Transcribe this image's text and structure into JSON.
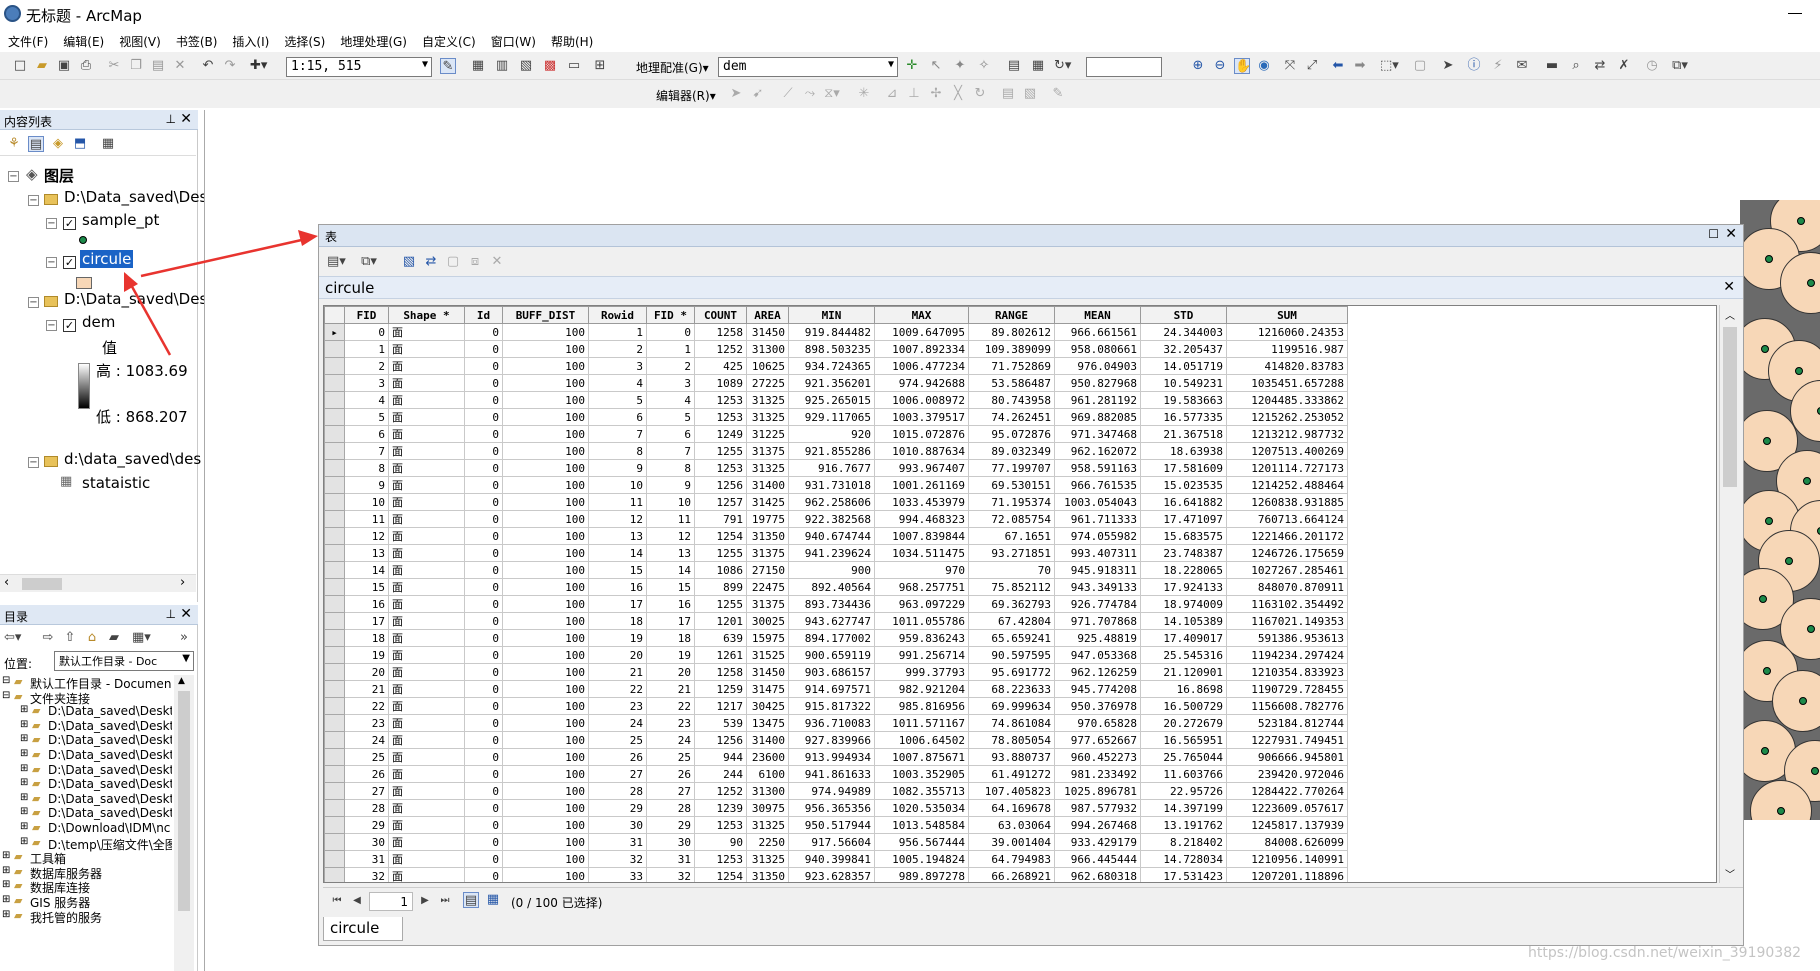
{
  "app": {
    "title": "无标题 - ArcMap"
  },
  "menu": [
    "文件(F)",
    "编辑(E)",
    "视图(V)",
    "书签(B)",
    "插入(I)",
    "选择(S)",
    "地理处理(G)",
    "自定义(C)",
    "窗口(W)",
    "帮助(H)"
  ],
  "toolbar": {
    "scale": "1:15, 515",
    "georef_label": "地理配准(G)▾",
    "georef_layer": "dem",
    "editor_label": "编辑器(R)▾"
  },
  "toc": {
    "title": "内容列表",
    "layers_label": "图层",
    "group1": "D:\\Data_saved\\Des",
    "layer_sample": "sample_pt",
    "layer_circle": "circule",
    "group2": "D:\\Data_saved\\Des",
    "layer_dem": "dem",
    "dem_value": "值",
    "dem_high": "高 : 1083.69",
    "dem_low": "低 : 868.207",
    "group3": "d:\\data_saved\\des",
    "table_name": "stataistic"
  },
  "catalog": {
    "title": "目录",
    "location_label": "位置:",
    "location_value": "默认工作目录 - Doc",
    "items": [
      "默认工作目录 - Documen",
      "文件夹连接",
      "D:\\Data_saved\\Deskt",
      "D:\\Data_saved\\Deskt",
      "D:\\Data_saved\\Deskt",
      "D:\\Data_saved\\Deskt",
      "D:\\Data_saved\\Deskt",
      "D:\\Data_saved\\Deskt",
      "D:\\Data_saved\\Deskt",
      "D:\\Data_saved\\Deskt",
      "D:\\Download\\IDM\\nc",
      "D:\\temp\\压缩文件\\全图",
      "工具箱",
      "数据库服务器",
      "数据库连接",
      "GIS 服务器",
      "我托管的服务"
    ]
  },
  "table_window": {
    "title": "表",
    "tab_name": "circule",
    "bottom_tab": "circule",
    "record_num": "1",
    "selection_status": "(0 / 100 已选择)",
    "columns": [
      "FID",
      "Shape *",
      "Id",
      "BUFF_DIST",
      "Rowid",
      "FID *",
      "COUNT",
      "AREA",
      "MIN",
      "MAX",
      "RANGE",
      "MEAN",
      "STD",
      "SUM"
    ],
    "rows": [
      [
        "0",
        "面",
        "0",
        "100",
        "1",
        "0",
        "1258",
        "31450",
        "919.844482",
        "1009.647095",
        "89.802612",
        "966.661561",
        "24.344003",
        "1216060.24353"
      ],
      [
        "1",
        "面",
        "0",
        "100",
        "2",
        "1",
        "1252",
        "31300",
        "898.503235",
        "1007.892334",
        "109.389099",
        "958.080661",
        "32.205437",
        "1199516.987"
      ],
      [
        "2",
        "面",
        "0",
        "100",
        "3",
        "2",
        "425",
        "10625",
        "934.724365",
        "1006.477234",
        "71.752869",
        "976.04903",
        "14.051719",
        "414820.83783"
      ],
      [
        "3",
        "面",
        "0",
        "100",
        "4",
        "3",
        "1089",
        "27225",
        "921.356201",
        "974.942688",
        "53.586487",
        "950.827968",
        "10.549231",
        "1035451.657288"
      ],
      [
        "4",
        "面",
        "0",
        "100",
        "5",
        "4",
        "1253",
        "31325",
        "925.265015",
        "1006.008972",
        "80.743958",
        "961.281192",
        "19.583663",
        "1204485.333862"
      ],
      [
        "5",
        "面",
        "0",
        "100",
        "6",
        "5",
        "1253",
        "31325",
        "929.117065",
        "1003.379517",
        "74.262451",
        "969.882085",
        "16.577335",
        "1215262.253052"
      ],
      [
        "6",
        "面",
        "0",
        "100",
        "7",
        "6",
        "1249",
        "31225",
        "920",
        "1015.072876",
        "95.072876",
        "971.347468",
        "21.367518",
        "1213212.987732"
      ],
      [
        "7",
        "面",
        "0",
        "100",
        "8",
        "7",
        "1255",
        "31375",
        "921.855286",
        "1010.887634",
        "89.032349",
        "962.162072",
        "18.63938",
        "1207513.400269"
      ],
      [
        "8",
        "面",
        "0",
        "100",
        "9",
        "8",
        "1253",
        "31325",
        "916.7677",
        "993.967407",
        "77.199707",
        "958.591163",
        "17.581609",
        "1201114.727173"
      ],
      [
        "9",
        "面",
        "0",
        "100",
        "10",
        "9",
        "1256",
        "31400",
        "931.731018",
        "1001.261169",
        "69.530151",
        "966.761535",
        "15.023535",
        "1214252.488464"
      ],
      [
        "10",
        "面",
        "0",
        "100",
        "11",
        "10",
        "1257",
        "31425",
        "962.258606",
        "1033.453979",
        "71.195374",
        "1003.054043",
        "16.641882",
        "1260838.931885"
      ],
      [
        "11",
        "面",
        "0",
        "100",
        "12",
        "11",
        "791",
        "19775",
        "922.382568",
        "994.468323",
        "72.085754",
        "961.711333",
        "17.471097",
        "760713.664124"
      ],
      [
        "12",
        "面",
        "0",
        "100",
        "13",
        "12",
        "1254",
        "31350",
        "940.674744",
        "1007.839844",
        "67.1651",
        "974.055982",
        "15.683575",
        "1221466.201172"
      ],
      [
        "13",
        "面",
        "0",
        "100",
        "14",
        "13",
        "1255",
        "31375",
        "941.239624",
        "1034.511475",
        "93.271851",
        "993.407311",
        "23.748387",
        "1246726.175659"
      ],
      [
        "14",
        "面",
        "0",
        "100",
        "15",
        "14",
        "1086",
        "27150",
        "900",
        "970",
        "70",
        "945.918311",
        "18.228065",
        "1027267.285461"
      ],
      [
        "15",
        "面",
        "0",
        "100",
        "16",
        "15",
        "899",
        "22475",
        "892.40564",
        "968.257751",
        "75.852112",
        "943.349133",
        "17.924133",
        "848070.870911"
      ],
      [
        "16",
        "面",
        "0",
        "100",
        "17",
        "16",
        "1255",
        "31375",
        "893.734436",
        "963.097229",
        "69.362793",
        "926.774784",
        "18.974009",
        "1163102.354492"
      ],
      [
        "17",
        "面",
        "0",
        "100",
        "18",
        "17",
        "1201",
        "30025",
        "943.627747",
        "1011.055786",
        "67.42804",
        "971.707868",
        "14.105389",
        "1167021.149353"
      ],
      [
        "18",
        "面",
        "0",
        "100",
        "19",
        "18",
        "639",
        "15975",
        "894.177002",
        "959.836243",
        "65.659241",
        "925.48819",
        "17.409017",
        "591386.953613"
      ],
      [
        "19",
        "面",
        "0",
        "100",
        "20",
        "19",
        "1261",
        "31525",
        "900.659119",
        "991.256714",
        "90.597595",
        "947.053368",
        "25.545316",
        "1194234.297424"
      ],
      [
        "20",
        "面",
        "0",
        "100",
        "21",
        "20",
        "1258",
        "31450",
        "903.686157",
        "999.37793",
        "95.691772",
        "962.126259",
        "21.120901",
        "1210354.833923"
      ],
      [
        "21",
        "面",
        "0",
        "100",
        "22",
        "21",
        "1259",
        "31475",
        "914.697571",
        "982.921204",
        "68.223633",
        "945.774208",
        "16.8698",
        "1190729.728455"
      ],
      [
        "22",
        "面",
        "0",
        "100",
        "23",
        "22",
        "1217",
        "30425",
        "915.817322",
        "985.816956",
        "69.999634",
        "950.376978",
        "16.500729",
        "1156608.782776"
      ],
      [
        "23",
        "面",
        "0",
        "100",
        "24",
        "23",
        "539",
        "13475",
        "936.710083",
        "1011.571167",
        "74.861084",
        "970.65828",
        "20.272679",
        "523184.812744"
      ],
      [
        "24",
        "面",
        "0",
        "100",
        "25",
        "24",
        "1256",
        "31400",
        "927.839966",
        "1006.64502",
        "78.805054",
        "977.652667",
        "16.565951",
        "1227931.749451"
      ],
      [
        "25",
        "面",
        "0",
        "100",
        "26",
        "25",
        "944",
        "23600",
        "913.994934",
        "1007.875671",
        "93.880737",
        "960.452273",
        "25.765044",
        "906666.945801"
      ],
      [
        "26",
        "面",
        "0",
        "100",
        "27",
        "26",
        "244",
        "6100",
        "941.861633",
        "1003.352905",
        "61.491272",
        "981.233492",
        "11.603766",
        "239420.972046"
      ],
      [
        "27",
        "面",
        "0",
        "100",
        "28",
        "27",
        "1252",
        "31300",
        "974.94989",
        "1082.355713",
        "107.405823",
        "1025.896781",
        "22.95726",
        "1284422.770264"
      ],
      [
        "28",
        "面",
        "0",
        "100",
        "29",
        "28",
        "1239",
        "30975",
        "956.365356",
        "1020.535034",
        "64.169678",
        "987.577932",
        "14.397199",
        "1223609.057617"
      ],
      [
        "29",
        "面",
        "0",
        "100",
        "30",
        "29",
        "1253",
        "31325",
        "950.517944",
        "1013.548584",
        "63.03064",
        "994.267468",
        "13.191762",
        "1245817.137939"
      ],
      [
        "30",
        "面",
        "0",
        "100",
        "31",
        "30",
        "90",
        "2250",
        "917.56604",
        "956.567444",
        "39.001404",
        "933.429179",
        "8.218402",
        "84008.626099"
      ],
      [
        "31",
        "面",
        "0",
        "100",
        "32",
        "31",
        "1253",
        "31325",
        "940.399841",
        "1005.194824",
        "64.794983",
        "966.445444",
        "14.728034",
        "1210956.140991"
      ],
      [
        "32",
        "面",
        "0",
        "100",
        "33",
        "32",
        "1254",
        "31350",
        "923.628357",
        "989.897278",
        "66.268921",
        "962.680318",
        "17.531423",
        "1207201.118896"
      ]
    ]
  },
  "watermark": "https://blog.csdn.net/weixin_39190382"
}
